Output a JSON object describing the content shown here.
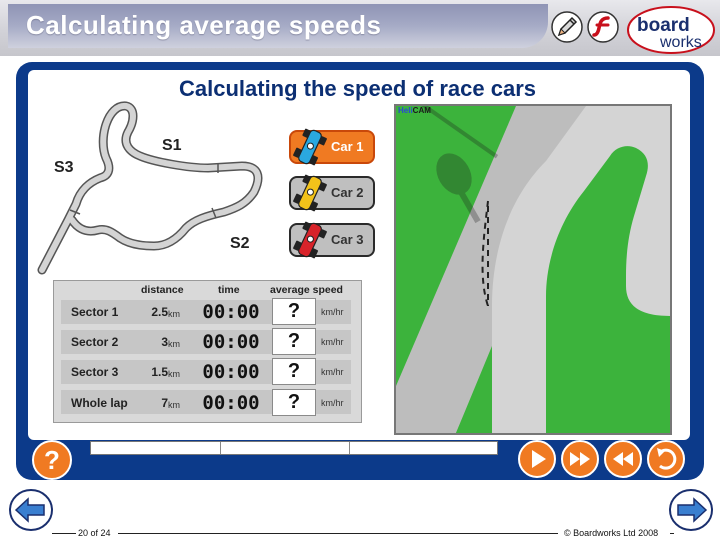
{
  "header": {
    "title": "Calculating average speeds",
    "logo_word1": "board",
    "logo_word2": "works"
  },
  "activity": {
    "title": "Calculating the speed of race cars",
    "track_labels": {
      "s1": "S1",
      "s2": "S2",
      "s3": "S3"
    }
  },
  "cars": [
    {
      "label": "Car 1",
      "color": "#2aa8e0",
      "selected": true
    },
    {
      "label": "Car 2",
      "color": "#f2c21a",
      "selected": false
    },
    {
      "label": "Car 3",
      "color": "#d8232a",
      "selected": false
    }
  ],
  "table": {
    "headers": {
      "distance": "distance",
      "time": "time",
      "speed": "average speed"
    },
    "rows": [
      {
        "name": "Sector 1",
        "distance": "2.5",
        "unit": "km",
        "time": "00:00",
        "speed": "?",
        "speed_unit": "km/hr"
      },
      {
        "name": "Sector 2",
        "distance": "3",
        "unit": "km",
        "time": "00:00",
        "speed": "?",
        "speed_unit": "km/hr"
      },
      {
        "name": "Sector 3",
        "distance": "1.5",
        "unit": "km",
        "time": "00:00",
        "speed": "?",
        "speed_unit": "km/hr"
      },
      {
        "name": "Whole lap",
        "distance": "7",
        "unit": "km",
        "time": "00:00",
        "speed": "?",
        "speed_unit": "km/hr"
      }
    ]
  },
  "helicam": {
    "label_a": "Heli",
    "label_b": "CAM"
  },
  "controls": {
    "help": "?",
    "icons": [
      "play-icon",
      "fast-forward-icon",
      "rewind-icon",
      "reset-icon"
    ]
  },
  "footer": {
    "page": "20 of 24",
    "copyright": "© Boardworks Ltd 2008"
  },
  "colors": {
    "frame": "#0c3a8a",
    "accent": "#f07a22",
    "grass": "#3cb33c",
    "road": "#d4d4d4"
  }
}
